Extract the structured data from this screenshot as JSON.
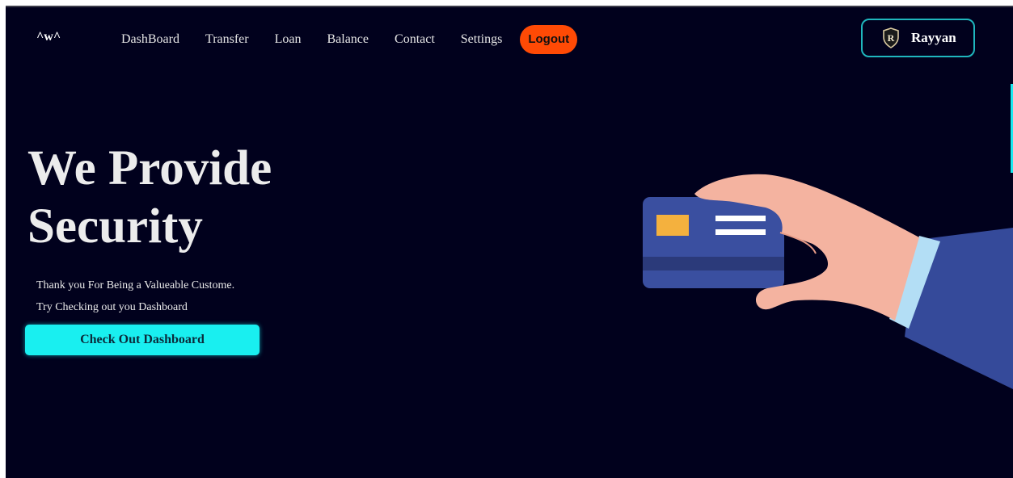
{
  "header": {
    "logo": "^w^",
    "nav": [
      "DashBoard",
      "Transfer",
      "Loan",
      "Balance",
      "Contact",
      "Settings"
    ],
    "logout_label": "Logout",
    "profile": {
      "initial": "R",
      "name": "Rayyan",
      "icon": "shield-icon"
    }
  },
  "hero": {
    "title_line1": "We Provide",
    "title_line2": "Security",
    "text_line1": "Thank you For Being a Valueable Custome.",
    "text_line2": "Try Checking out you Dashboard",
    "cta_label": "Check Out Dashboard",
    "illustration": "hand-holding-credit-card-icon"
  },
  "colors": {
    "background": "#01011d",
    "accent": "#19eff0",
    "logout": "#ff4a05",
    "profile_border": "#1fb6bd",
    "card": "#3a4fa0",
    "skin": "#f4b3a0",
    "sleeve": "#354a9a",
    "cuff": "#b3def5"
  }
}
